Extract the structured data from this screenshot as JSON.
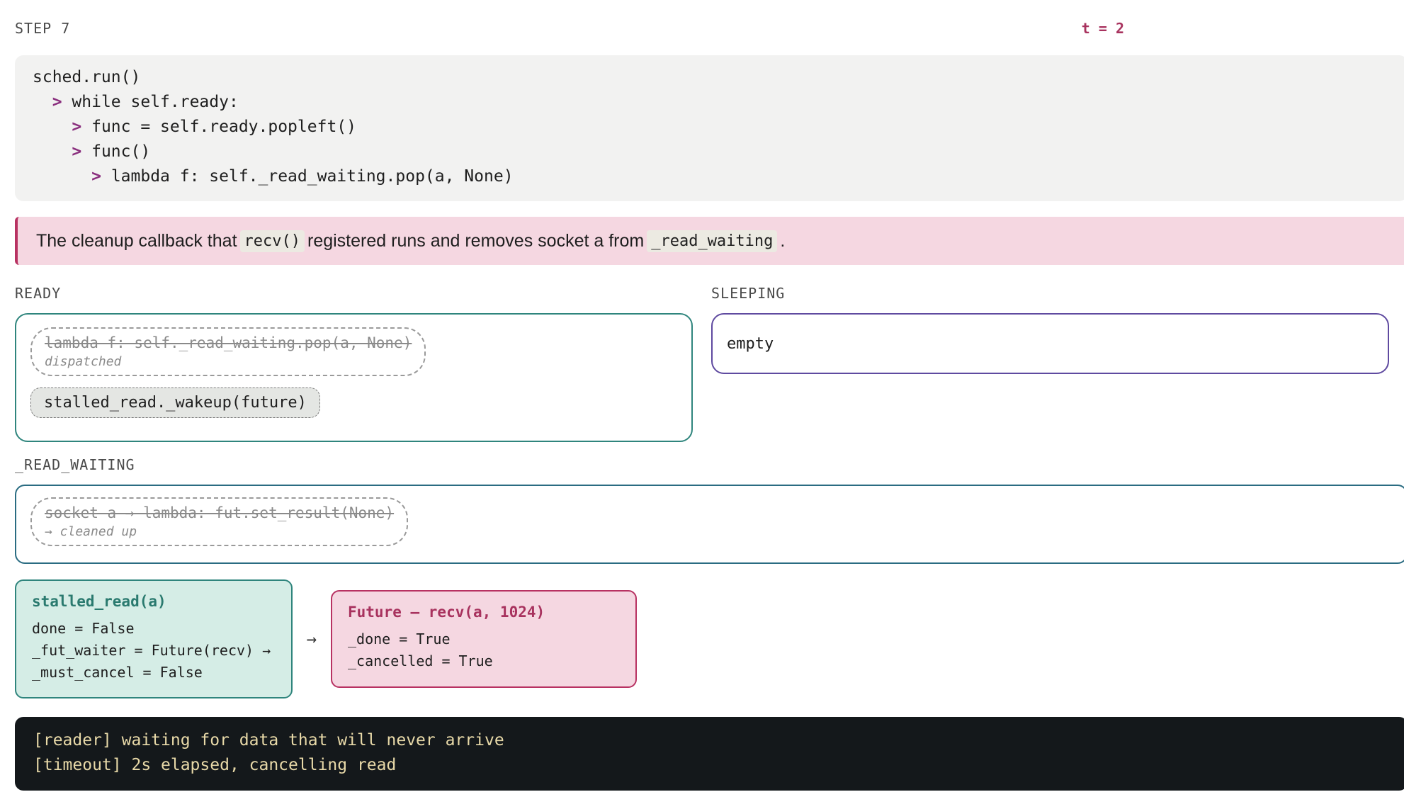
{
  "header": {
    "step": "STEP 7",
    "time": "t = 2"
  },
  "code": {
    "lines": [
      {
        "arrow": "",
        "text": "sched.run()"
      },
      {
        "arrow": ">",
        "text": "while self.ready:"
      },
      {
        "arrow": ">",
        "text": "func = self.ready.popleft()"
      },
      {
        "arrow": ">",
        "text": "func()"
      },
      {
        "arrow": ">",
        "text": "lambda f: self._read_waiting.pop(a, None)"
      }
    ]
  },
  "note": {
    "part1": "The cleanup callback that",
    "code1": "recv()",
    "part2": "registered runs and removes socket a from",
    "code2": "_read_waiting",
    "part3": "."
  },
  "ready": {
    "label": "READY",
    "dispatched_item": "lambda f: self._read_waiting.pop(a, None)",
    "dispatched_note": "dispatched",
    "pending_item": "stalled_read._wakeup(future)"
  },
  "sleeping": {
    "label": "SLEEPING",
    "value": "empty"
  },
  "read_waiting": {
    "label": "_READ_WAITING",
    "item": "socket a → lambda: fut.set_result(None)",
    "note": "→ cleaned up"
  },
  "task": {
    "title": "stalled_read(a)",
    "fields": [
      "done = False",
      "_fut_waiter = Future(recv) →",
      "_must_cancel = False"
    ]
  },
  "chain_arrow": "→",
  "future": {
    "title": "Future — recv(a, 1024)",
    "fields": [
      "_done = True",
      "_cancelled = True"
    ]
  },
  "terminal": {
    "lines": [
      "[reader] waiting for data that will never arrive",
      "[timeout] 2s elapsed, cancelling read"
    ]
  },
  "colors": {
    "accent_pink": "#b83262",
    "ready_border": "#2f857d",
    "sleeping_border": "#5f4aa0",
    "read_waiting_border": "#2a6c82",
    "terminal_bg": "#14181b"
  }
}
